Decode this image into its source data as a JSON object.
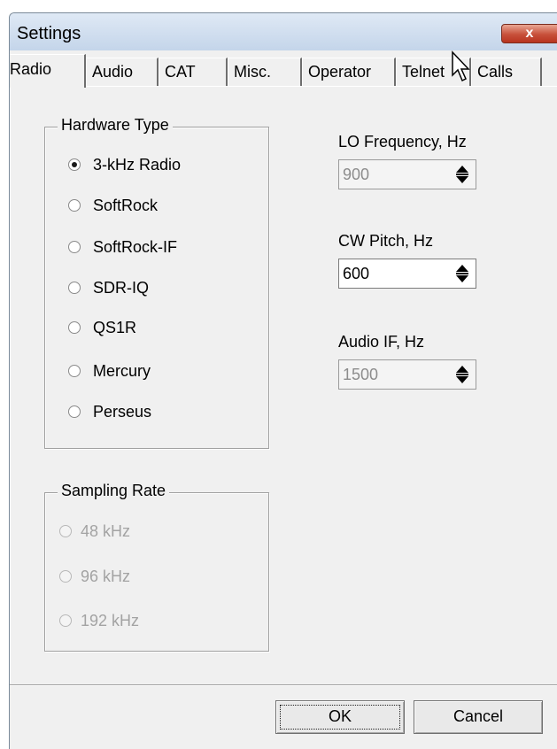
{
  "window": {
    "title": "Settings",
    "close_label": "x"
  },
  "tabs": [
    {
      "label": "Radio",
      "active": true
    },
    {
      "label": "Audio"
    },
    {
      "label": "CAT"
    },
    {
      "label": "Misc."
    },
    {
      "label": "Operator"
    },
    {
      "label": "Telnet"
    },
    {
      "label": "Calls"
    }
  ],
  "hardware_type": {
    "legend": "Hardware Type",
    "options": [
      "3-kHz Radio",
      "SoftRock",
      "SoftRock-IF",
      "SDR-IQ",
      "QS1R",
      "Mercury",
      "Perseus"
    ],
    "selected": "3-kHz Radio"
  },
  "sampling_rate": {
    "legend": "Sampling Rate",
    "options": [
      "48 kHz",
      "96 kHz",
      "192 kHz"
    ],
    "enabled": false
  },
  "lo_frequency": {
    "label": "LO Frequency, Hz",
    "value": "900",
    "enabled": false
  },
  "cw_pitch": {
    "label": "CW Pitch, Hz",
    "value": "600",
    "enabled": true
  },
  "audio_if": {
    "label": "Audio IF, Hz",
    "value": "1500",
    "enabled": false
  },
  "buttons": {
    "ok": "OK",
    "cancel": "Cancel"
  }
}
